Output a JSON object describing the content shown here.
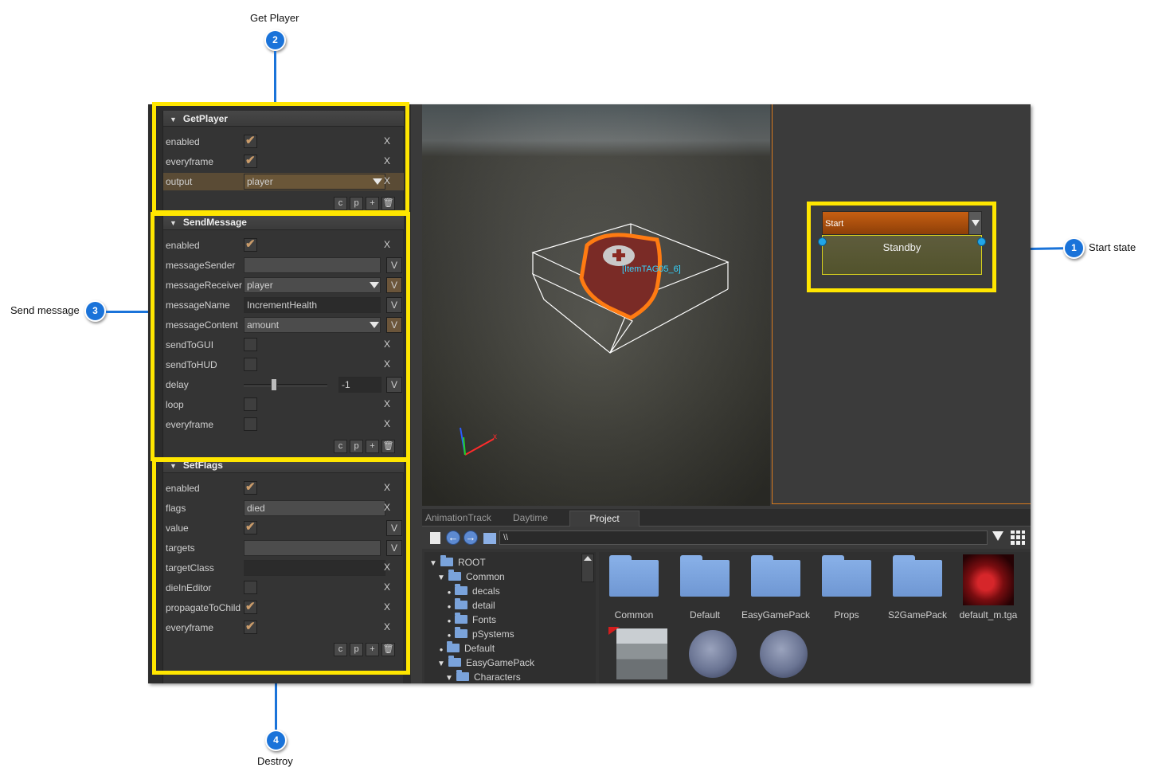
{
  "callouts": [
    {
      "num": "1",
      "label": "Start state"
    },
    {
      "num": "2",
      "label": "Get Player"
    },
    {
      "num": "3",
      "label": "Send message"
    },
    {
      "num": "4",
      "label": "Destroy"
    }
  ],
  "inspector": {
    "getplayer": {
      "title": "GetPlayer",
      "enabled_label": "enabled",
      "enabled": true,
      "everyframe_label": "everyframe",
      "everyframe": true,
      "output_label": "output",
      "output_value": "player"
    },
    "sendmessage": {
      "title": "SendMessage",
      "enabled_label": "enabled",
      "messageSender_label": "messageSender",
      "messageSender_value": "",
      "messageReceiver_label": "messageReceiver",
      "messageReceiver_value": "player",
      "messageName_label": "messageName",
      "messageName_value": "IncrementHealth",
      "messageContent_label": "messageContent",
      "messageContent_value": "amount",
      "sendToGUI_label": "sendToGUI",
      "sendToHUD_label": "sendToHUD",
      "delay_label": "delay",
      "delay_value": "-1",
      "loop_label": "loop",
      "everyframe_label": "everyframe"
    },
    "setflags": {
      "title": "SetFlags",
      "enabled_label": "enabled",
      "flags_label": "flags",
      "flags_value": "died",
      "value_label": "value",
      "targets_label": "targets",
      "targets_value": "",
      "targetClass_label": "targetClass",
      "targetClass_value": "",
      "dieInEditor_label": "dieInEditor",
      "propagateToChild_label": "propagateToChild",
      "everyframe_label": "everyframe"
    },
    "buttons": {
      "c": "c",
      "p": "p",
      "plus": "+",
      "x": "X",
      "v": "V"
    }
  },
  "viewport": {
    "item_tag": "[ItemTAG05_6]"
  },
  "state_node": {
    "header": "Start",
    "name": "Standby"
  },
  "bottom_tabs": [
    "AnimationTrack",
    "Daytime",
    "Project"
  ],
  "active_tab": "Project",
  "path": "\\\\",
  "tree": [
    "ROOT",
    "Common",
    "decals",
    "detail",
    "Fonts",
    "pSystems",
    "Default",
    "EasyGamePack",
    "Characters"
  ],
  "assets": [
    "Common",
    "Default",
    "EasyGamePack",
    "Props",
    "S2GamePack",
    "default_m.tga"
  ],
  "colors": {
    "callout": "#1a73d9",
    "highlight_box": "#ffe600",
    "state_header": "#c75f12",
    "accent_border": "#d87a1e"
  }
}
